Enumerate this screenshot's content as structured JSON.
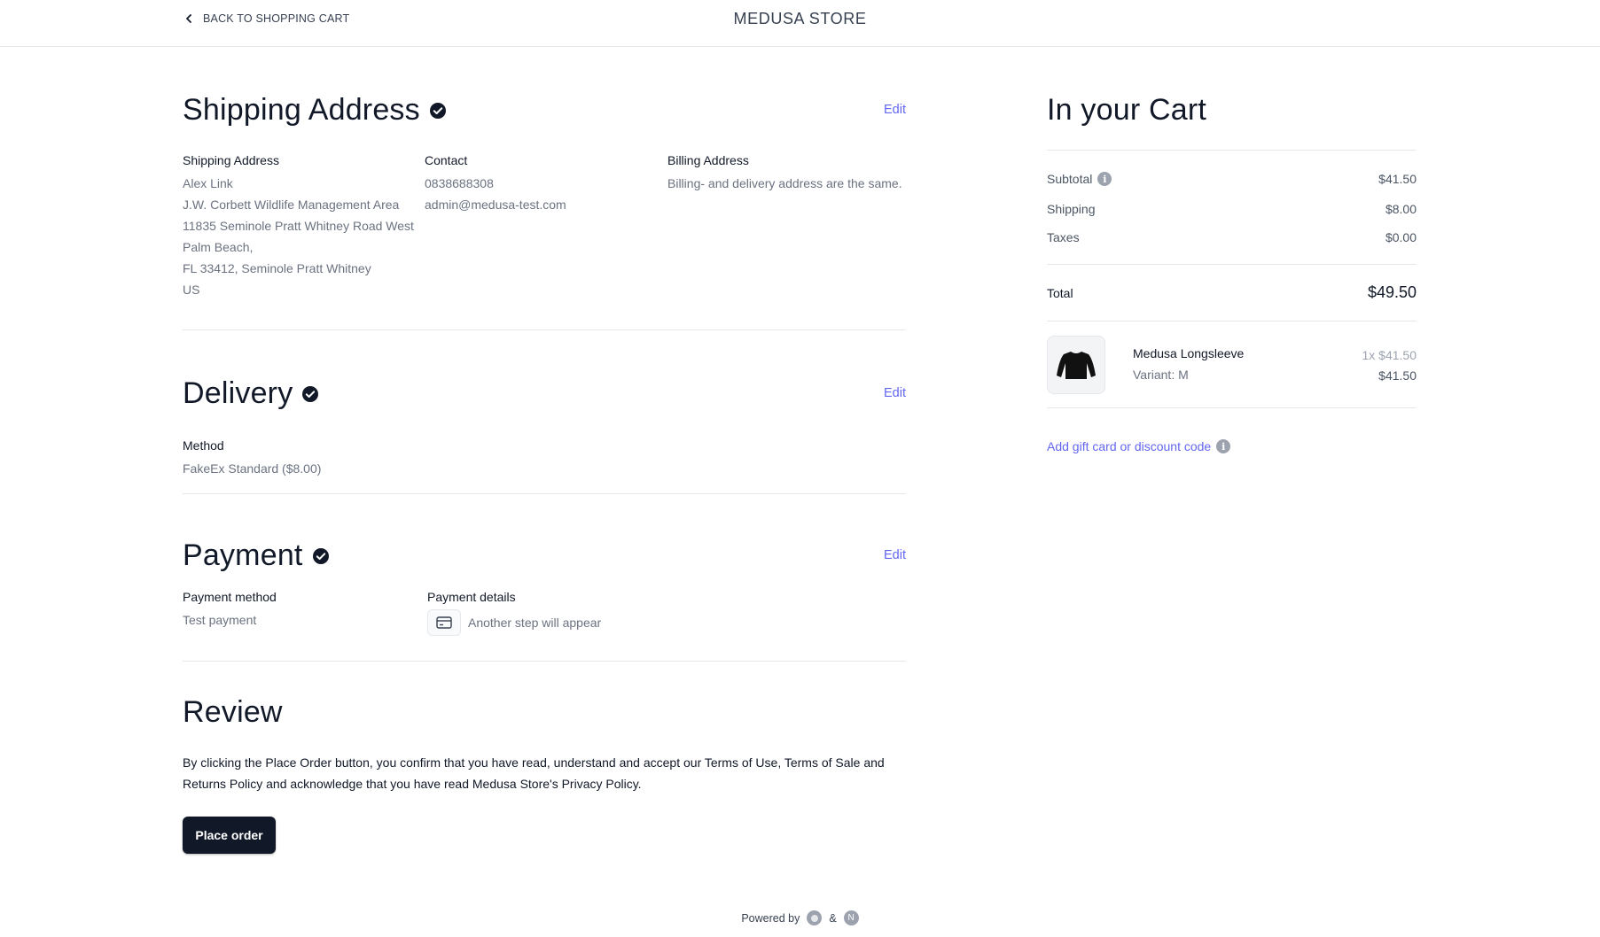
{
  "header": {
    "back_label": "BACK TO SHOPPING CART",
    "store_name": "MEDUSA STORE"
  },
  "shipping": {
    "title": "Shipping Address",
    "edit_label": "Edit",
    "address": {
      "label": "Shipping Address",
      "lines": [
        "Alex Link",
        "J.W. Corbett Wildlife Management Area",
        "11835 Seminole Pratt Whitney Road West",
        "Palm Beach,",
        "FL 33412, Seminole Pratt Whitney",
        "US"
      ]
    },
    "contact": {
      "label": "Contact",
      "phone": "0838688308",
      "email": "admin@medusa-test.com"
    },
    "billing": {
      "label": "Billing Address",
      "text": "Billing- and delivery address are the same."
    }
  },
  "delivery": {
    "title": "Delivery",
    "edit_label": "Edit",
    "method_label": "Method",
    "method_value": "FakeEx Standard ($8.00)"
  },
  "payment": {
    "title": "Payment",
    "edit_label": "Edit",
    "method_label": "Payment method",
    "method_value": "Test payment",
    "details_label": "Payment details",
    "details_value": "Another step will appear"
  },
  "review": {
    "title": "Review",
    "text": "By clicking the Place Order button, you confirm that you have read, understand and accept our Terms of Use, Terms of Sale and Returns Policy and acknowledge that you have read Medusa Store's Privacy Policy.",
    "button_label": "Place order"
  },
  "cart": {
    "title": "In your Cart",
    "subtotal_label": "Subtotal",
    "subtotal_value": "$41.50",
    "shipping_label": "Shipping",
    "shipping_value": "$8.00",
    "taxes_label": "Taxes",
    "taxes_value": "$0.00",
    "total_label": "Total",
    "total_value": "$49.50",
    "item": {
      "name": "Medusa Longsleeve",
      "variant": "Variant: M",
      "qty_price": "1x $41.50",
      "price": "$41.50"
    },
    "gift_label": "Add gift card or discount code"
  },
  "footer": {
    "powered_by": "Powered by",
    "ampersand": "&",
    "logo_letter": "N"
  },
  "colors": {
    "accent": "#6366f1",
    "button_bg": "#111827",
    "muted_text": "#6b7280"
  },
  "icons": {
    "back": "chevron-left-icon",
    "check": "check-circle-icon",
    "info": "info-icon",
    "card": "credit-card-icon"
  }
}
